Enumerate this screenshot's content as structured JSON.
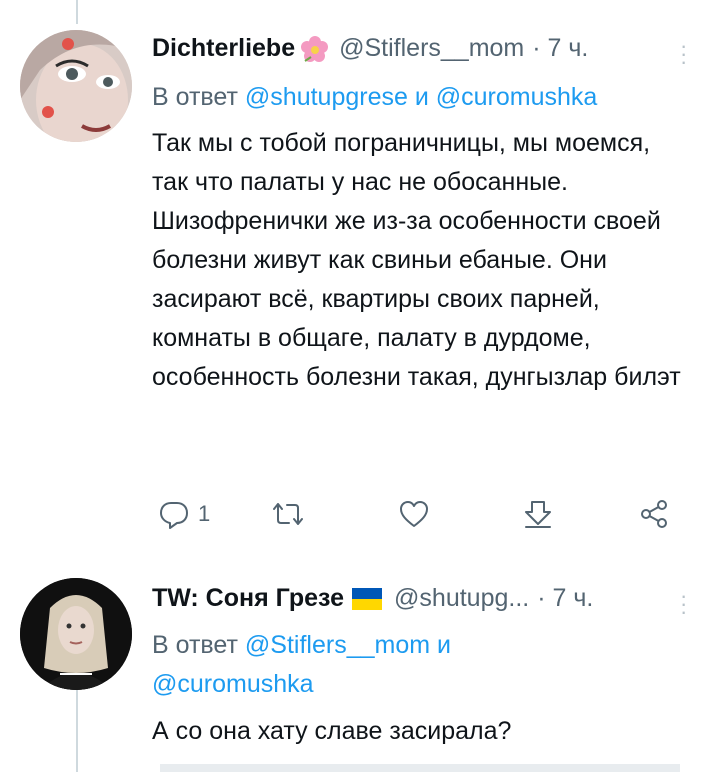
{
  "tweets": [
    {
      "display_name": "Dichterliebe",
      "handle": "@Stiflers__mom",
      "time": "· 7 ч.",
      "reply_prefix": "В ответ",
      "reply_mention_1": "@shutupgrese",
      "reply_and": "и",
      "reply_mention_2": "@curomushka",
      "text": "Так мы с тобой пограничницы, мы моемся, так что палаты у нас не обосанные. Шизофренички же из-за особенности своей болезни живут как свиньи ебаные. Они засирают всё, квартиры своих парней, комнаты в общаге, палату в дурдоме, особенность болезни такая, дунгызлар билэт",
      "reply_count": "1",
      "icons": [
        "reply-icon",
        "retweet-icon",
        "like-icon",
        "share-icon",
        "more-share-icon"
      ]
    },
    {
      "display_name": "TW: Соня Грезе",
      "handle": "@shutupg...",
      "time": "· 7 ч.",
      "reply_prefix": "В ответ",
      "reply_mention_1": "@Stiflers__mom",
      "reply_and": "и",
      "reply_mention_2": "@curomushka",
      "text": "А со она хату славе засирала?"
    }
  ],
  "colors": {
    "accent": "#1d9bf0",
    "secondary_text": "#536471",
    "primary_text": "#0f1419"
  }
}
